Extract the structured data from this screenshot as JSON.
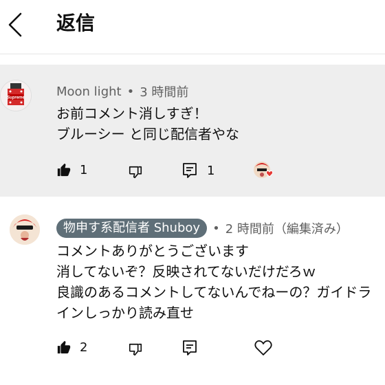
{
  "header": {
    "title": "返信"
  },
  "comments": [
    {
      "author": "Moon light",
      "time": "3 時間前",
      "lines": [
        "お前コメント消しすぎ！",
        "ブルーシー と同じ配信者やな"
      ],
      "likes": "1",
      "replies": "1",
      "avatar_text": "Supreme",
      "hearted": true
    },
    {
      "author": "物申す系配信者 Shuboy",
      "time": "2 時間前（編集済み）",
      "lines": [
        "コメントありがとうございます",
        "消してないぞ？反映されてないだけだろｗ",
        "良識のあるコメントしてないんでねーの？ガイドラ",
        "インしっかり読み直せ"
      ],
      "likes": "2"
    }
  ],
  "icons": {
    "back": "chevron-left-icon",
    "like": "thumbs-up-icon",
    "dislike": "thumbs-down-icon",
    "reply": "reply-icon",
    "heart": "heart-icon"
  },
  "colors": {
    "highlight_bg": "#eeeeee",
    "badge_bg": "#5f6f78",
    "heart": "#e53935",
    "meta": "#606060"
  }
}
